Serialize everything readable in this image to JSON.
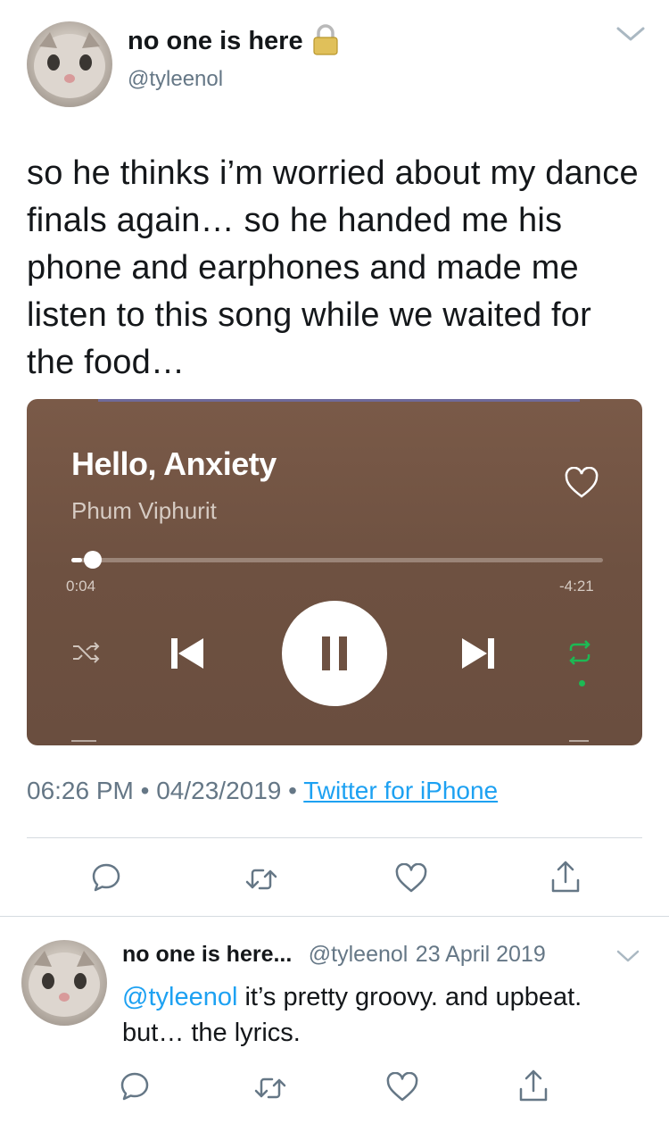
{
  "tweet": {
    "author_name": "no one is here",
    "author_handle": "@tyleenol",
    "text": "so he thinks i’m worried about my dance finals again… so he handed me his phone and earphones and made me listen to this song while we waited for the food…",
    "time": "06:26 PM",
    "separator": "•",
    "date": "04/23/2019",
    "source": "Twitter for iPhone"
  },
  "player": {
    "song_title": "Hello, Anxiety",
    "artist": "Phum Viphurit",
    "elapsed": "0:04",
    "remaining": "-4:21",
    "progress_fraction": 0.02,
    "colors": {
      "background": "#6e5141",
      "accent_green": "#1db954",
      "track": "#9b8578"
    }
  },
  "reply": {
    "author_name": "no one is here...",
    "author_handle": "@tyleenol",
    "date": "23 April 2019",
    "mention": "@tyleenol",
    "text": " it’s pretty groovy. and upbeat. but… the lyrics."
  },
  "colors": {
    "link": "#1da1f2",
    "secondary_text": "#657786",
    "divider": "#d5dbe0"
  }
}
